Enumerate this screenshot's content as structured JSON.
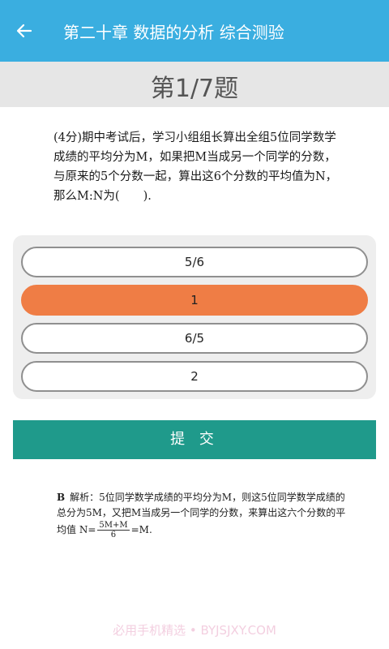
{
  "header": {
    "title": "第二十章 数据的分析  综合测验"
  },
  "question": {
    "counter": "第1/7题",
    "text": "(4分)期中考试后，学习小组组长算出全组5位同学数学成绩的平均分为M，如果把M当成另一个同学的分数，与原来的5个分数一起，算出这6个分数的平均值为N，那么M:N为(　　)."
  },
  "options": [
    {
      "label": "5/6",
      "selected": false
    },
    {
      "label": "1",
      "selected": true
    },
    {
      "label": "6/5",
      "selected": false
    },
    {
      "label": "2",
      "selected": false
    }
  ],
  "submit_label": "提 交",
  "analysis": {
    "answer": "B",
    "text_before": "解析：5位同学数学成绩的平均分为M，则这5位同学数学成绩的总分为5M，又把M当成另一个同学的分数，来算出这六个分数的平均值 N=",
    "frac_num": "5M+M",
    "frac_den": "6",
    "text_after": "=M."
  },
  "watermark": "必用手机精选 • BYJSJXY.COM",
  "colors": {
    "appbar": "#3aaee0",
    "selected": "#ef7d45",
    "submit": "#1f9a8b"
  }
}
